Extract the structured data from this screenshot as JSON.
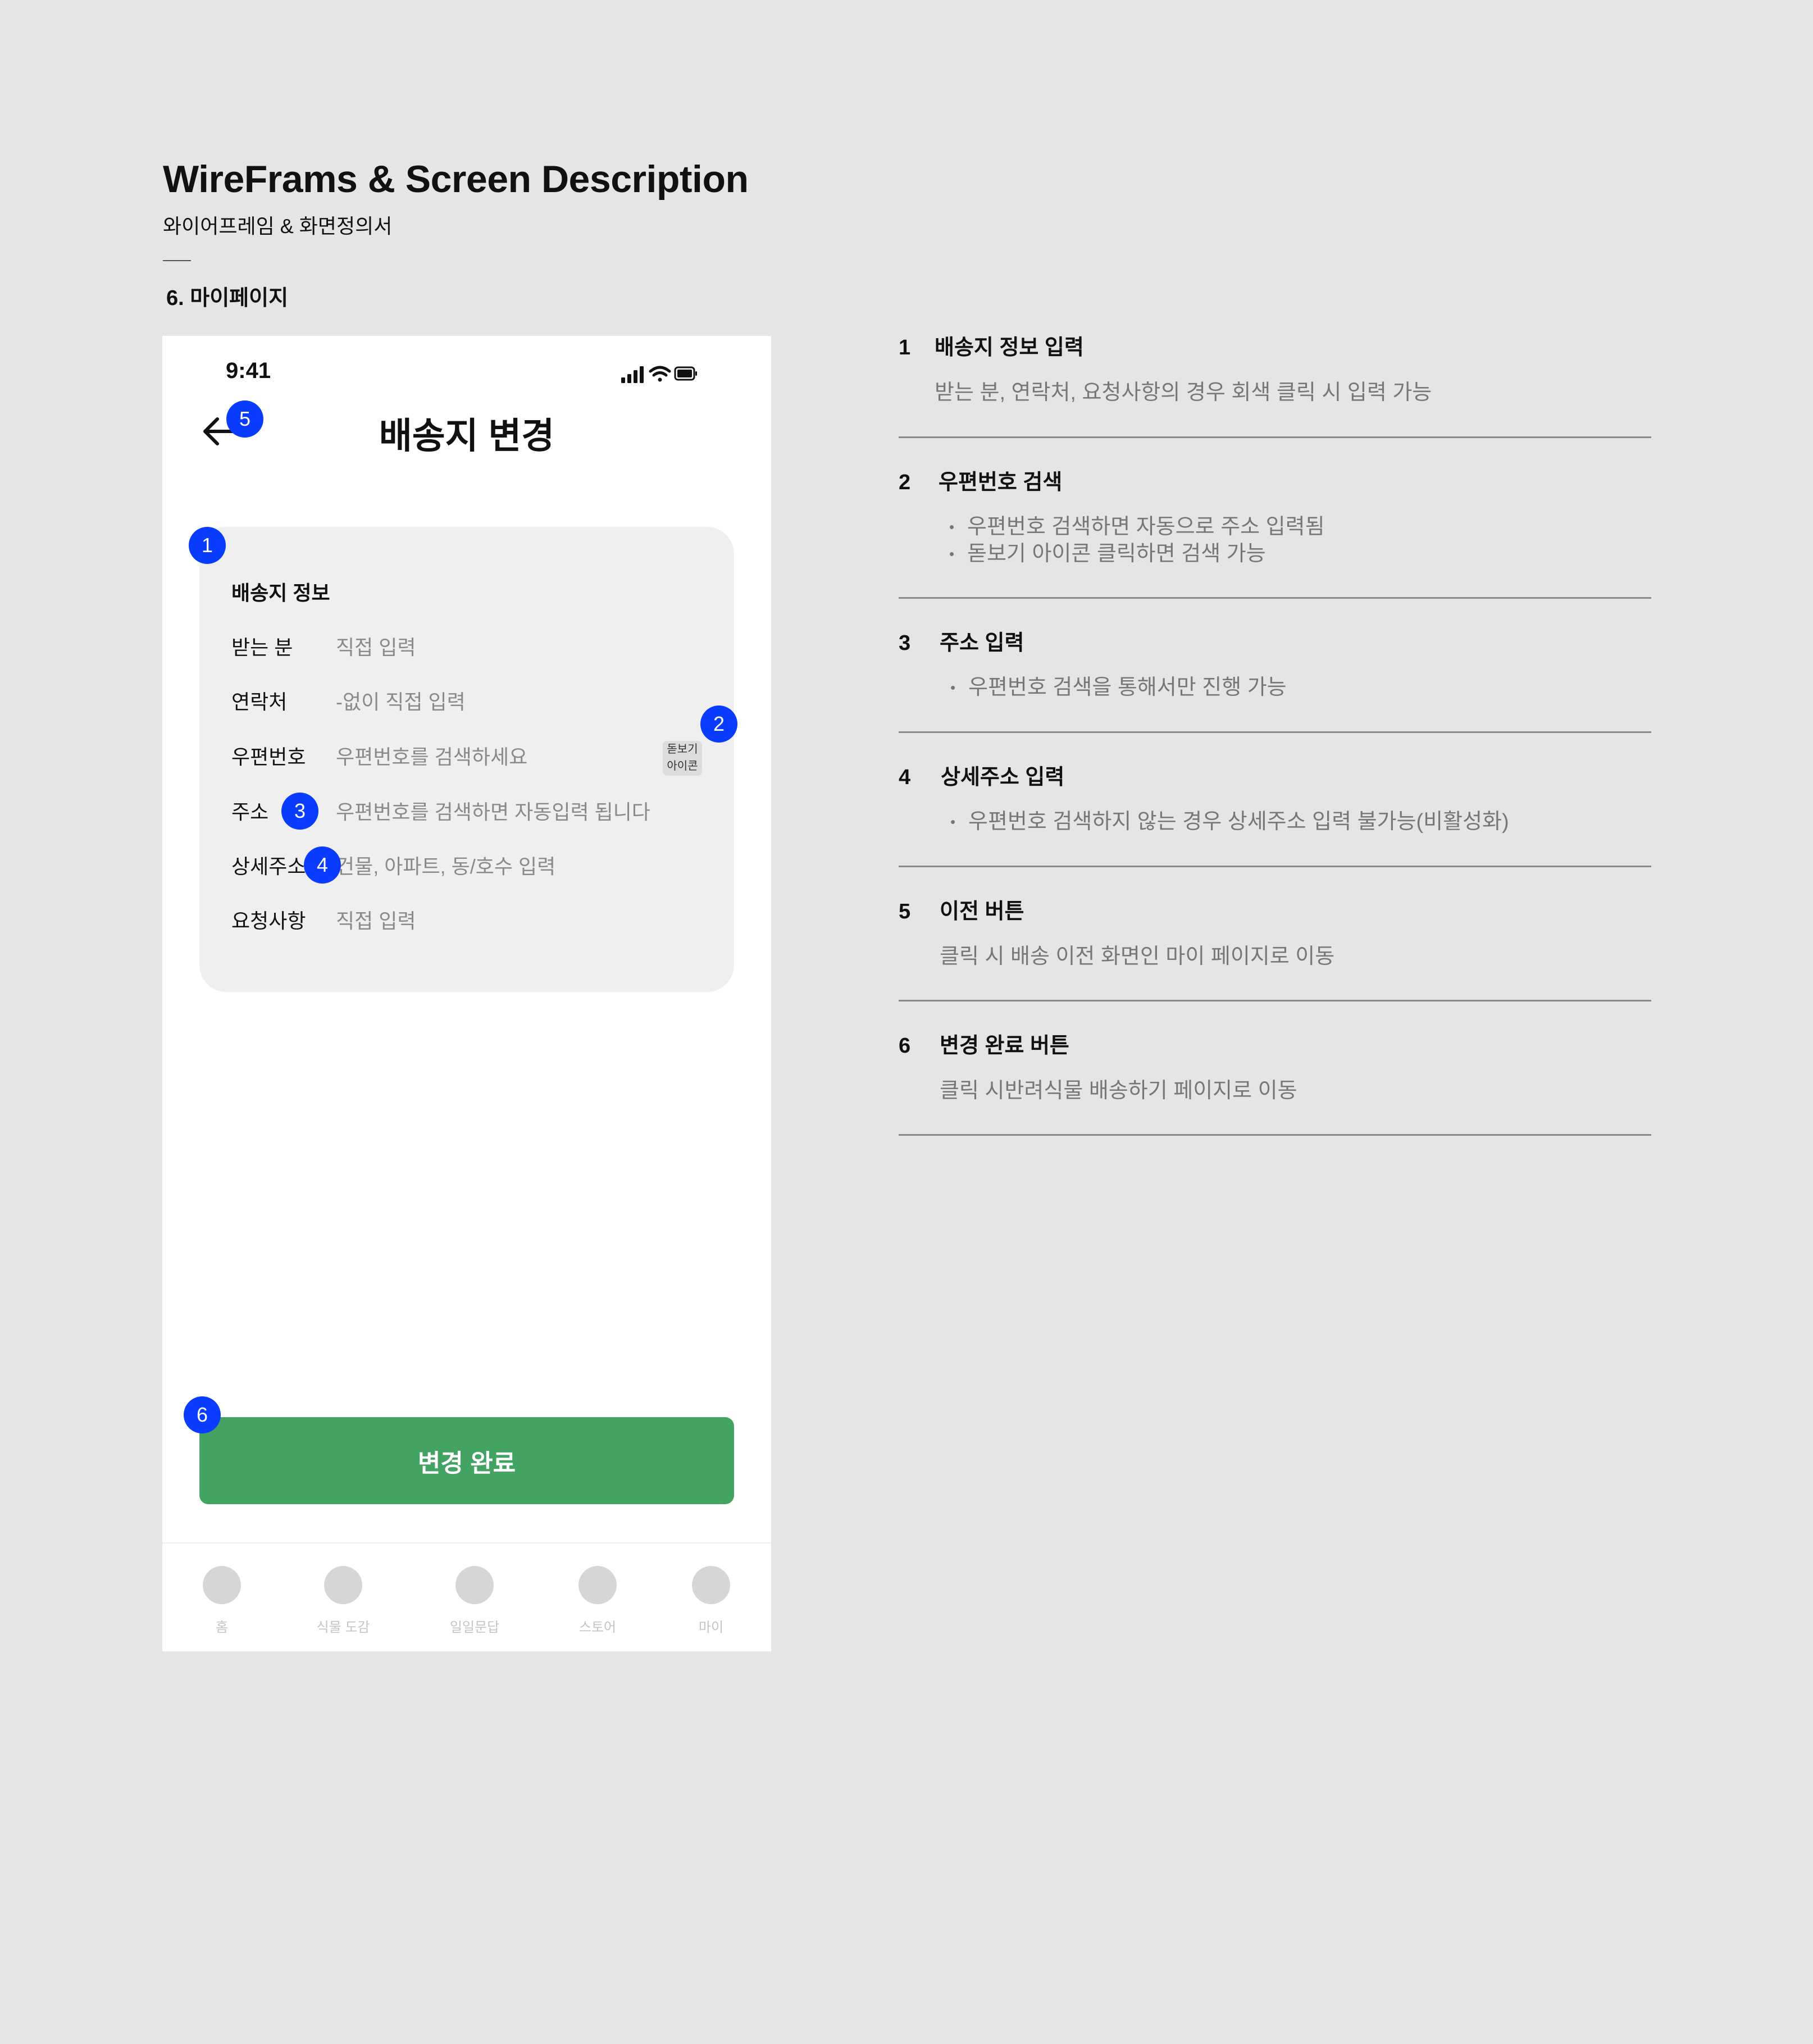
{
  "doc": {
    "title": "WireFrams & Screen Description",
    "subtitle": "와이어프레임 & 화면정의서",
    "section": "6. 마이페이지"
  },
  "phone": {
    "status_time": "9:41",
    "screen_title": "배송지 변경",
    "card": {
      "title": "배송지 정보",
      "fields": [
        {
          "label": "받는 분",
          "placeholder": "직접 입력"
        },
        {
          "label": "연락처",
          "placeholder": "-없이 직접 입력"
        },
        {
          "label": "우편번호",
          "placeholder": "우편번호를 검색하세요"
        },
        {
          "label": "주소",
          "placeholder": "우편번호를 검색하면 자동입력 됩니다"
        },
        {
          "label": "상세주소",
          "placeholder": "건물, 아파트, 동/호수 입력"
        },
        {
          "label": "요청사항",
          "placeholder": "직접 입력"
        }
      ],
      "search_icon_line1": "돋보기",
      "search_icon_line2": "아이콘"
    },
    "submit_label": "변경 완료",
    "tabs": [
      {
        "label": "홈"
      },
      {
        "label": "식물 도감"
      },
      {
        "label": "일일문답"
      },
      {
        "label": "스토어"
      },
      {
        "label": "마이"
      }
    ],
    "badges": [
      "1",
      "2",
      "3",
      "4",
      "5",
      "6"
    ]
  },
  "descriptions": [
    {
      "num": "1",
      "title": "배송지 정보 입력",
      "text": "받는 분, 연락처, 요청사항의 경우 회색 클릭 시 입력 가능"
    },
    {
      "num": "2",
      "title": "우편번호 검색",
      "bullets": [
        "우편번호 검색하면 자동으로 주소 입력됨",
        "돋보기 아이콘 클릭하면 검색 가능"
      ]
    },
    {
      "num": "3",
      "title": "주소 입력",
      "bullets": [
        "우편번호 검색을 통해서만 진행 가능"
      ]
    },
    {
      "num": "4",
      "title": "상세주소 입력",
      "bullets": [
        "우편번호 검색하지 않는 경우 상세주소 입력 불가능(비활성화)"
      ]
    },
    {
      "num": "5",
      "title": "이전 버튼",
      "text": "클릭 시 배송 이전 화면인 마이 페이지로 이동"
    },
    {
      "num": "6",
      "title": "변경 완료 버튼",
      "text": "클릭 시반려식물 배송하기 페이지로 이동"
    }
  ],
  "colors": {
    "badge": "#0a3cff",
    "cta": "#43a363",
    "background": "#e5e5e5"
  }
}
